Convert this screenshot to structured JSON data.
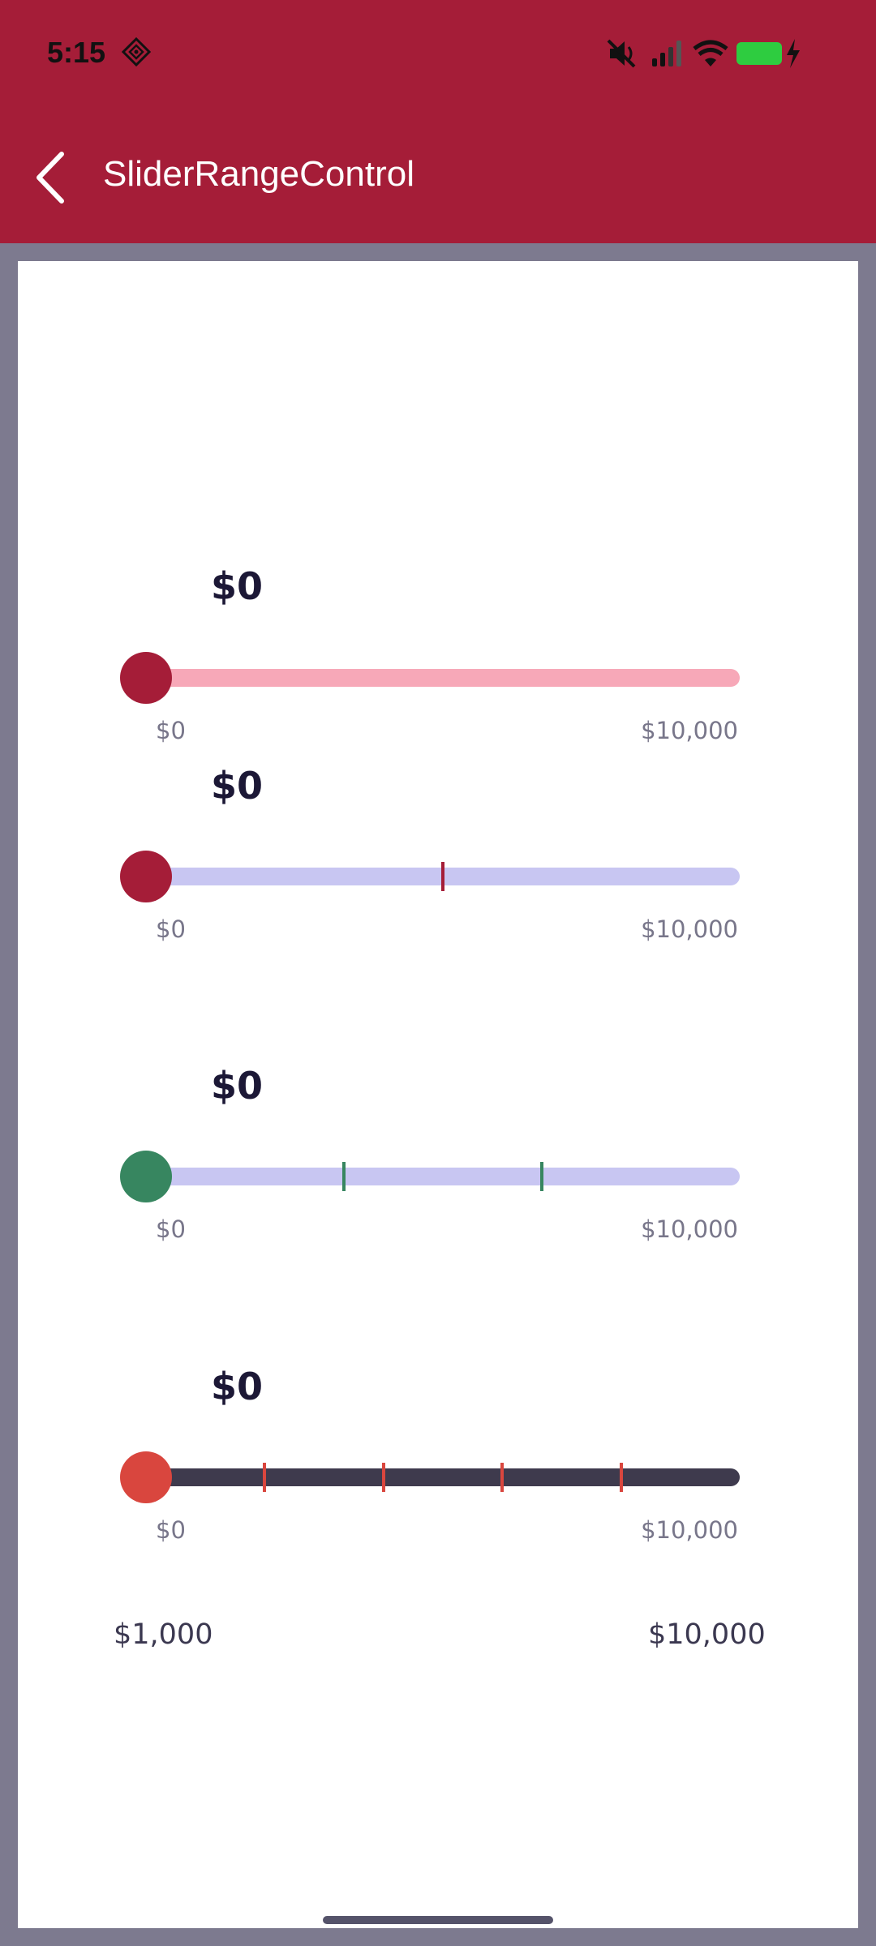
{
  "status_bar": {
    "time": "5:15",
    "icons": [
      "diamond-app-icon",
      "mute-icon",
      "signal-icon",
      "wifi-icon",
      "battery-charging-icon"
    ],
    "battery_color": "#2ecc40"
  },
  "app_bar": {
    "title": "SliderRangeControl",
    "color": "#a51d38"
  },
  "sliders": [
    {
      "value_label": "$0",
      "min_label": "$0",
      "max_label": "$10,000",
      "value_fraction": 0,
      "track_color": "#f7a8b8",
      "thumb_color": "#a51d38",
      "tick_color": null,
      "ticks": []
    },
    {
      "value_label": "$0",
      "min_label": "$0",
      "max_label": "$10,000",
      "value_fraction": 0,
      "track_color": "#c8c6f2",
      "thumb_color": "#a51d38",
      "tick_color": "#a51d38",
      "ticks": [
        0.5
      ]
    },
    {
      "value_label": "$0",
      "min_label": "$0",
      "max_label": "$10,000",
      "value_fraction": 0,
      "track_color": "#c8c6f2",
      "thumb_color": "#378660",
      "tick_color": "#378660",
      "ticks": [
        0.333,
        0.667
      ]
    },
    {
      "value_label": "$0",
      "min_label": "$0",
      "max_label": "$10,000",
      "value_fraction": 0,
      "track_color": "#3e3a4d",
      "thumb_color": "#d9463e",
      "tick_color": "#d9463e",
      "ticks": [
        0.2,
        0.4,
        0.6,
        0.8
      ]
    }
  ],
  "range_labels": {
    "min": "$1,000",
    "max": "$10,000"
  }
}
